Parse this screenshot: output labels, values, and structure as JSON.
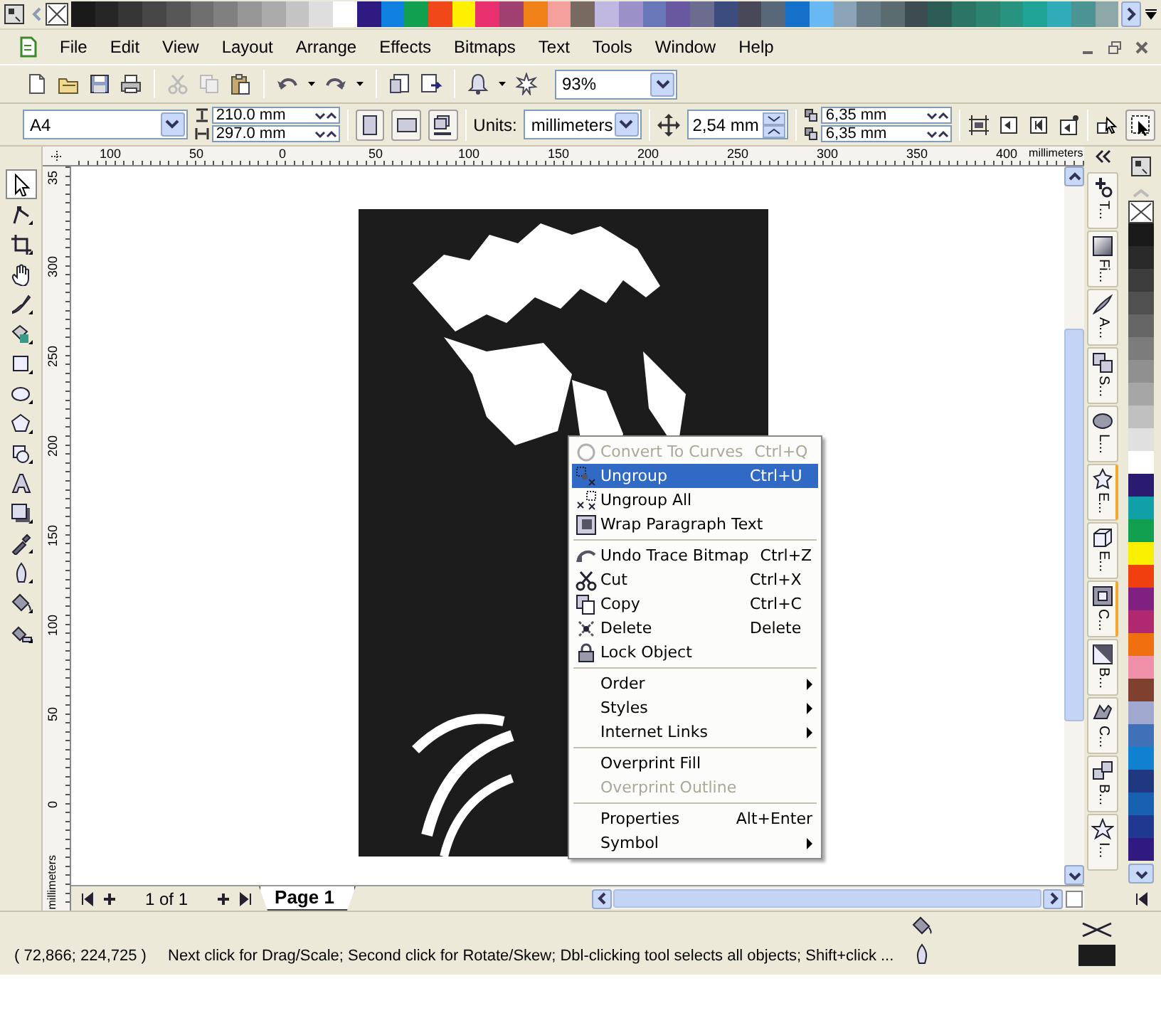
{
  "color_palette": {
    "swatches": [
      {
        "color": "#1a1a1a"
      },
      {
        "color": "#262626"
      },
      {
        "color": "#363636"
      },
      {
        "color": "#474747"
      },
      {
        "color": "#575757"
      },
      {
        "color": "#6e6e6e"
      },
      {
        "color": "#808080"
      },
      {
        "color": "#979797"
      },
      {
        "color": "#ababab"
      },
      {
        "color": "#c4c4c4"
      },
      {
        "color": "#dedede"
      },
      {
        "color": "#ffffff"
      },
      {
        "color": "#2e1a80"
      },
      {
        "color": "#1080e0"
      },
      {
        "color": "#10a050"
      },
      {
        "color": "#f04818"
      },
      {
        "color": "#fff000"
      },
      {
        "color": "#e8306e"
      },
      {
        "color": "#a04070"
      },
      {
        "color": "#f08018"
      },
      {
        "color": "#f4a09c"
      },
      {
        "color": "#786a60"
      },
      {
        "color": "#c0b8e0"
      },
      {
        "color": "#9c90c8"
      },
      {
        "color": "#6878b8"
      },
      {
        "color": "#6858a0"
      },
      {
        "color": "#6c6c90"
      },
      {
        "color": "#3c4c7c"
      },
      {
        "color": "#484858"
      },
      {
        "color": "#586878"
      },
      {
        "color": "#1470c8"
      },
      {
        "color": "#68b8f4"
      },
      {
        "color": "#8ca4b8"
      },
      {
        "color": "#687c88"
      },
      {
        "color": "#5a6c70"
      },
      {
        "color": "#3c4c50"
      },
      {
        "color": "#2c5c54"
      },
      {
        "color": "#2c7464"
      },
      {
        "color": "#2c8470"
      },
      {
        "color": "#289480"
      },
      {
        "color": "#20a498"
      },
      {
        "color": "#30acb8"
      },
      {
        "color": "#4c9494"
      },
      {
        "color": "#8ca8a8"
      }
    ]
  },
  "menu_bar": {
    "items": [
      "File",
      "Edit",
      "View",
      "Layout",
      "Arrange",
      "Effects",
      "Bitmaps",
      "Text",
      "Tools",
      "Window",
      "Help"
    ]
  },
  "standard_toolbar": {
    "zoom": "93%"
  },
  "property_bar": {
    "paper": "A4",
    "width": "210.0 mm",
    "height": "297.0 mm",
    "units_label": "Units:",
    "units": "millimeters",
    "nudge": "2,54 mm",
    "duplicate_x": "6,35 mm",
    "duplicate_y": "6,35 mm"
  },
  "horizontal_ruler": {
    "labels": [
      "100",
      "50",
      "0",
      "50",
      "100",
      "150",
      "200",
      "250",
      "300",
      "350",
      "400"
    ],
    "unit": "millimeters"
  },
  "vertical_ruler": {
    "labels": [
      "35",
      "300",
      "250",
      "200",
      "150",
      "100",
      "50",
      "0"
    ],
    "unit": "millimeters"
  },
  "toolbox": {
    "tools": [
      {
        "selected": true
      },
      {
        "selected": false
      },
      {
        "selected": false
      },
      {
        "selected": false
      },
      {
        "selected": false
      },
      {
        "selected": false
      },
      {
        "selected": false
      },
      {
        "selected": false
      },
      {
        "selected": false
      },
      {
        "selected": false
      },
      {
        "selected": false
      },
      {
        "selected": false
      },
      {
        "selected": false
      },
      {
        "selected": false
      },
      {
        "selected": false
      },
      {
        "selected": false
      }
    ]
  },
  "context_menu": {
    "items": [
      {
        "kind": "command",
        "label": "Convert To Curves",
        "shortcut": "Ctrl+Q",
        "disabled": true,
        "selected": false
      },
      {
        "kind": "command",
        "label": "Ungroup",
        "shortcut": "Ctrl+U",
        "disabled": false,
        "selected": true
      },
      {
        "kind": "command",
        "label": "Ungroup All",
        "disabled": false,
        "selected": false
      },
      {
        "kind": "command",
        "label": "Wrap Paragraph Text",
        "disabled": false,
        "selected": false
      },
      {
        "kind": "separator"
      },
      {
        "kind": "command",
        "label": "Undo Trace Bitmap",
        "shortcut": "Ctrl+Z",
        "disabled": false,
        "selected": false
      },
      {
        "kind": "command",
        "label": "Cut",
        "shortcut": "Ctrl+X",
        "disabled": false,
        "selected": false
      },
      {
        "kind": "command",
        "label": "Copy",
        "shortcut": "Ctrl+C",
        "disabled": false,
        "selected": false
      },
      {
        "kind": "command",
        "label": "Delete",
        "shortcut": "Delete",
        "disabled": false,
        "selected": false
      },
      {
        "kind": "command",
        "label": "Lock Object",
        "disabled": false,
        "selected": false
      },
      {
        "kind": "separator"
      },
      {
        "kind": "submenu",
        "label": "Order",
        "disabled": false,
        "selected": false
      },
      {
        "kind": "submenu",
        "label": "Styles",
        "disabled": false,
        "selected": false
      },
      {
        "kind": "submenu",
        "label": "Internet Links",
        "disabled": false,
        "selected": false
      },
      {
        "kind": "separator"
      },
      {
        "kind": "command",
        "label": "Overprint Fill",
        "disabled": false,
        "selected": false
      },
      {
        "kind": "command",
        "label": "Overprint Outline",
        "disabled": true,
        "selected": false
      },
      {
        "kind": "separator"
      },
      {
        "kind": "command",
        "label": "Properties",
        "shortcut": "Alt+Enter",
        "disabled": false,
        "selected": false
      },
      {
        "kind": "submenu",
        "label": "Symbol",
        "disabled": false,
        "selected": false
      }
    ]
  },
  "dockers": {
    "tabs": [
      {
        "label": "T...",
        "open": false
      },
      {
        "label": "Fi...",
        "open": false
      },
      {
        "label": "A...",
        "open": false
      },
      {
        "label": "S...",
        "open": false
      },
      {
        "label": "L...",
        "open": false
      },
      {
        "label": "E...",
        "open": true
      },
      {
        "label": "E...",
        "open": false
      },
      {
        "label": "C...",
        "open": true
      },
      {
        "label": "B...",
        "open": false
      },
      {
        "label": "C...",
        "open": false
      },
      {
        "label": "B...",
        "open": false
      },
      {
        "label": "I...",
        "open": false
      }
    ]
  },
  "side_palette": {
    "swatches": [
      {
        "color": "#1a1a1a"
      },
      {
        "color": "#2a2a2a"
      },
      {
        "color": "#3c3c3c"
      },
      {
        "color": "#505050"
      },
      {
        "color": "#666666"
      },
      {
        "color": "#7c7c7c"
      },
      {
        "color": "#909090"
      },
      {
        "color": "#a6a6a6"
      },
      {
        "color": "#c0c0c0"
      },
      {
        "color": "#e0e0e0"
      },
      {
        "color": "#ffffff"
      },
      {
        "color": "#2a1a70"
      },
      {
        "color": "#10a0a8"
      },
      {
        "color": "#10a050"
      },
      {
        "color": "#f8f000"
      },
      {
        "color": "#f04010"
      },
      {
        "color": "#802080"
      },
      {
        "color": "#b02870"
      },
      {
        "color": "#f07010"
      },
      {
        "color": "#f090a8"
      },
      {
        "color": "#804030"
      },
      {
        "color": "#a0a8d0"
      },
      {
        "color": "#4070b8"
      },
      {
        "color": "#1080d0"
      },
      {
        "color": "#203880"
      },
      {
        "color": "#1860b0"
      },
      {
        "color": "#203890"
      },
      {
        "color": "#301a80"
      }
    ]
  },
  "page_navigator": {
    "page_count": "1 of 1",
    "page_tab": "Page 1"
  },
  "status_bar": {
    "coordinates": "( 72,866; 224,725 )",
    "message": "Next click for Drag/Scale; Second click for Rotate/Skew; Dbl-clicking tool selects all objects; Shift+click ..."
  }
}
